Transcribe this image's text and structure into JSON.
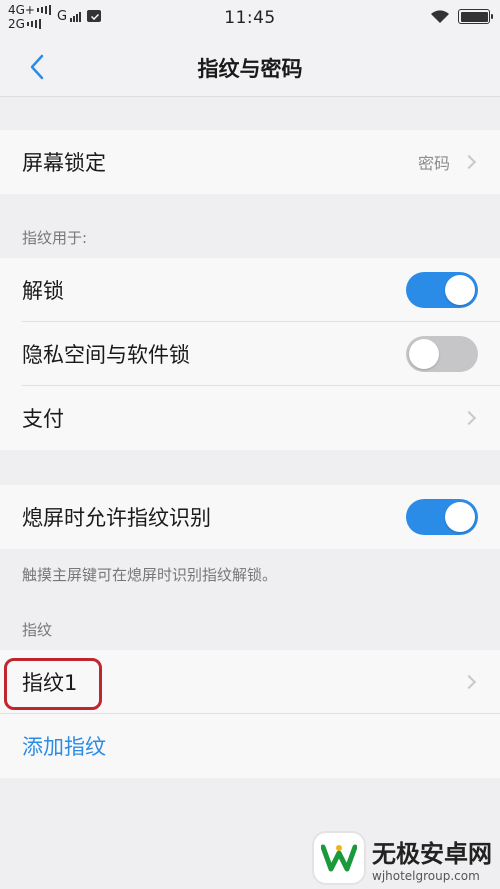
{
  "status_bar": {
    "net1": "4G+",
    "net2": "2G",
    "carrier": "G",
    "time": "11:45",
    "icons": [
      "signal-icon",
      "message-icon",
      "wifi-icon",
      "battery-icon"
    ]
  },
  "nav": {
    "title": "指纹与密码",
    "back_icon": "chevron-left-icon"
  },
  "screen_lock": {
    "label": "屏幕锁定",
    "value": "密码"
  },
  "fingerprint_for": {
    "header": "指纹用于:",
    "items": [
      {
        "label": "解锁",
        "toggle": true
      },
      {
        "label": "隐私空间与软件锁",
        "toggle": false
      },
      {
        "label": "支付"
      }
    ]
  },
  "screen_off": {
    "label": "熄屏时允许指纹识别",
    "toggle": true,
    "note": "触摸主屏键可在熄屏时识别指纹解锁。"
  },
  "fingerprints": {
    "header": "指纹",
    "items": [
      {
        "label": "指纹1"
      }
    ],
    "add_label": "添加指纹"
  },
  "watermark": {
    "title": "无极安卓网",
    "url": "wjhotelgroup.com"
  },
  "colors": {
    "accent": "#2b8ce8",
    "highlight": "#c0262d",
    "toggle_off": "#c6c6c9"
  }
}
